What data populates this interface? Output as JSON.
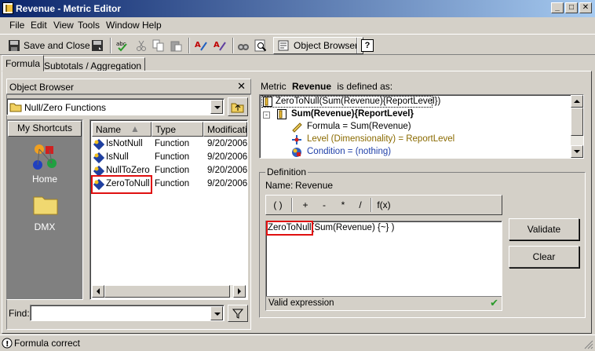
{
  "window": {
    "title": "Revenue - Metric Editor",
    "controls": [
      "minimize",
      "maximize",
      "close"
    ]
  },
  "menu": [
    "File",
    "Edit",
    "View",
    "Tools",
    "Window",
    "Help"
  ],
  "toolbar": {
    "save_close_label": "Save and Close",
    "object_browser_label": "Object Browser"
  },
  "tabs": [
    {
      "label": "Formula",
      "active": true
    },
    {
      "label": "Subtotals / Aggregation",
      "active": false
    }
  ],
  "object_browser": {
    "title": "Object Browser",
    "folder": "Null/Zero Functions",
    "shortcuts_label": "My Shortcuts",
    "shortcuts": [
      "Home",
      "DMX"
    ],
    "columns": [
      "Name",
      "Type",
      "Modificatio"
    ],
    "rows": [
      {
        "name": "IsNotNull",
        "type": "Function",
        "modified": "9/20/2006"
      },
      {
        "name": "IsNull",
        "type": "Function",
        "modified": "9/20/2006"
      },
      {
        "name": "NullToZero",
        "type": "Function",
        "modified": "9/20/2006"
      },
      {
        "name": "ZeroToNull",
        "type": "Function",
        "modified": "9/20/2006",
        "highlighted": true
      }
    ],
    "find_label": "Find:",
    "find_value": ""
  },
  "metric": {
    "defined_prefix": "Metric",
    "name": "Revenue",
    "defined_suffix": "is defined as:",
    "tree": {
      "root": "ZeroToNull(Sum(Revenue){ReportLevel})",
      "child": "Sum(Revenue){ReportLevel}",
      "formula": "Formula = Sum(Revenue)",
      "level": "Level (Dimensionality) = ReportLevel",
      "condition": "Condition = (nothing)"
    }
  },
  "definition": {
    "group_label": "Definition",
    "name_label": "Name:",
    "name_value": "Revenue",
    "operators": [
      "( )",
      "+",
      "-",
      "*",
      "/",
      "f(x)"
    ],
    "expression_fn": "ZeroToNull",
    "expression_rest": "(Sum(Revenue) {~} )",
    "status": "Valid expression",
    "validate_label": "Validate",
    "clear_label": "Clear"
  },
  "status_bar": {
    "text": "Formula correct"
  },
  "colors": {
    "face": "#d4d0c8",
    "title_start": "#0a246a",
    "title_end": "#a6caf0",
    "highlight": "#e01010",
    "link_blue": "#1f3fa8",
    "level_olive": "#8a6a00"
  }
}
